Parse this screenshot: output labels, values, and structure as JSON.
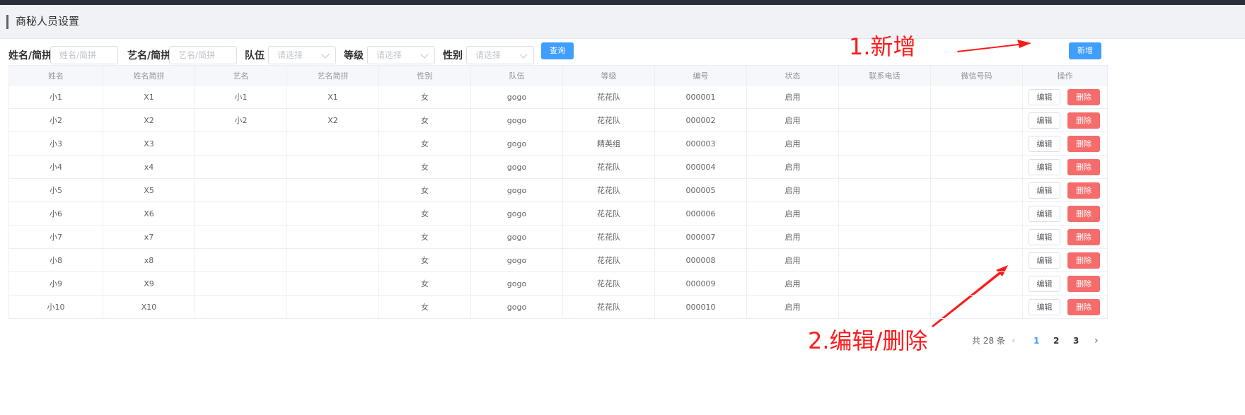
{
  "page": {
    "title": "商秘人员设置"
  },
  "filters": {
    "name_label": "姓名/简拼",
    "name_placeholder": "姓名/简拼",
    "stage_label": "艺名/简拼",
    "stage_placeholder": "艺名/简拼",
    "team_label": "队伍",
    "team_placeholder": "请选择",
    "level_label": "等级",
    "level_placeholder": "请选择",
    "gender_label": "性别",
    "gender_placeholder": "请选择",
    "query_button": "查询"
  },
  "toolbar": {
    "add_button": "新增"
  },
  "annotations": {
    "add": "1.新增",
    "edit_delete": "2.编辑/删除"
  },
  "table": {
    "columns": [
      "姓名",
      "姓名简拼",
      "艺名",
      "艺名简拼",
      "性别",
      "队伍",
      "等级",
      "编号",
      "状态",
      "联系电话",
      "微信号码",
      "操作"
    ],
    "edit_label": "编辑",
    "delete_label": "删除",
    "rows": [
      [
        "小1",
        "X1",
        "小1",
        "X1",
        "女",
        "gogo",
        "花花队",
        "000001",
        "启用",
        "",
        ""
      ],
      [
        "小2",
        "X2",
        "小2",
        "X2",
        "女",
        "gogo",
        "花花队",
        "000002",
        "启用",
        "",
        ""
      ],
      [
        "小3",
        "X3",
        "",
        "",
        "女",
        "gogo",
        "精英组",
        "000003",
        "启用",
        "",
        ""
      ],
      [
        "小4",
        "x4",
        "",
        "",
        "女",
        "gogo",
        "花花队",
        "000004",
        "启用",
        "",
        ""
      ],
      [
        "小5",
        "X5",
        "",
        "",
        "女",
        "gogo",
        "花花队",
        "000005",
        "启用",
        "",
        ""
      ],
      [
        "小6",
        "X6",
        "",
        "",
        "女",
        "gogo",
        "花花队",
        "000006",
        "启用",
        "",
        ""
      ],
      [
        "小7",
        "x7",
        "",
        "",
        "女",
        "gogo",
        "花花队",
        "000007",
        "启用",
        "",
        ""
      ],
      [
        "小8",
        "x8",
        "",
        "",
        "女",
        "gogo",
        "花花队",
        "000008",
        "启用",
        "",
        ""
      ],
      [
        "小9",
        "X9",
        "",
        "",
        "女",
        "gogo",
        "花花队",
        "000009",
        "启用",
        "",
        ""
      ],
      [
        "小10",
        "X10",
        "",
        "",
        "女",
        "gogo",
        "花花队",
        "000010",
        "启用",
        "",
        ""
      ]
    ]
  },
  "pagination": {
    "total_text": "共 28 条",
    "pages": [
      "1",
      "2",
      "3"
    ],
    "current": "1"
  },
  "colors": {
    "primary": "#409eff",
    "danger": "#f56c6c",
    "annotation": "#ff1a1a"
  }
}
